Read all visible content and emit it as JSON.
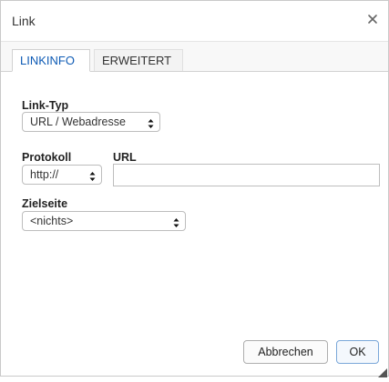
{
  "dialog": {
    "title": "Link"
  },
  "tabs": [
    {
      "label": "LINKINFO",
      "active": true
    },
    {
      "label": "ERWEITERT",
      "active": false
    }
  ],
  "link_type": {
    "label": "Link-Typ",
    "value": "URL / Webadresse"
  },
  "protocol": {
    "label": "Protokoll",
    "value": "http://"
  },
  "url": {
    "label": "URL",
    "value": ""
  },
  "target": {
    "label": "Zielseite",
    "value": "<nichts>"
  },
  "buttons": {
    "cancel": "Abbrechen",
    "ok": "OK"
  },
  "colors": {
    "accent": "#0e5bb5",
    "border": "#bdbdbd",
    "tab_bg": "#f8f8f8"
  },
  "icons": {
    "close": "close-icon",
    "select_arrows": "select-arrows-icon",
    "resize": "resize-grip-icon"
  }
}
